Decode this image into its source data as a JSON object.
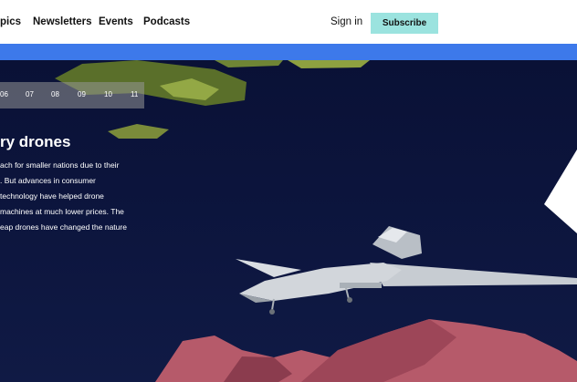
{
  "header": {
    "nav_items": [
      "pics",
      "Newsletters",
      "Events",
      "Podcasts"
    ],
    "signin_label": "Sign in",
    "subscribe_label": "Subscribe"
  },
  "colors": {
    "accent_bar": "#3d79ea",
    "subscribe_bg": "#9be3df",
    "hero_bg": "#0b1236"
  },
  "hero": {
    "pager": [
      "06",
      "07",
      "08",
      "09",
      "10",
      "11"
    ],
    "title": "ry drones",
    "body_lines": [
      "ach for smaller nations due to their",
      ". But advances in consumer",
      "technology have helped drone",
      "machines at much lower prices. The",
      "eap drones have changed the nature"
    ]
  },
  "icons": {
    "drone": "drone-illustration"
  }
}
